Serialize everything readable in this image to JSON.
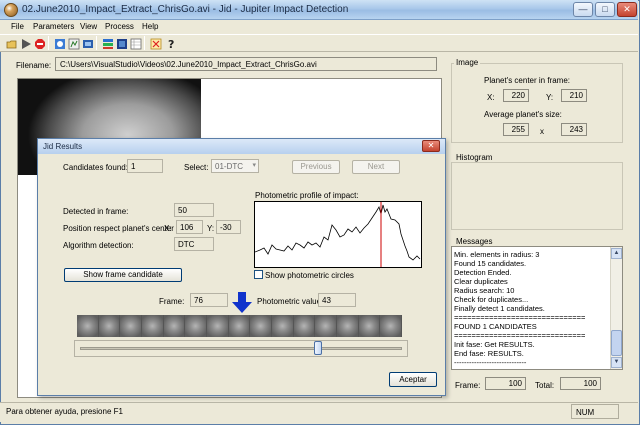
{
  "window": {
    "title": "02.June2010_Impact_Extract_ChrisGo.avi - Jid - Jupiter Impact Detection",
    "minimize": "—",
    "maximize": "□",
    "close": "✕"
  },
  "menu": [
    "File",
    "Parameters",
    "View",
    "Process",
    "Help"
  ],
  "toolbar_icons": [
    "open-icon",
    "play-icon",
    "stop-icon",
    "capture-icon",
    "process-icon",
    "film-icon",
    "layers-icon",
    "stack-icon",
    "grid-icon",
    "chart-icon",
    "help-icon"
  ],
  "filename": {
    "label": "Filename:",
    "value": "C:\\Users\\VisualStudio\\Videos\\02.June2010_Impact_Extract_ChrisGo.avi"
  },
  "image_panel": {
    "title": "Image",
    "center_label": "Planet's center in frame:",
    "x_label": "X:",
    "x_value": "220",
    "y_label": "Y:",
    "y_value": "210",
    "size_label": "Average planet's size:",
    "width_value": "255",
    "times": "x",
    "height_value": "243"
  },
  "histogram": {
    "title": "Histogram"
  },
  "messages": {
    "title": "Messages",
    "lines": [
      "Min. elements in radius: 3",
      "Found 15 candidates.",
      "Detection Ended.",
      "Clear duplicates",
      "Radius search: 10",
      "Check for duplicates...",
      "Finally detect 1 candidates.",
      "==============================",
      "FOUND 1 CANDIDATES",
      "==============================",
      "Init fase: Get RESULTS.",
      "End fase: RESULTS.",
      "-----------------------------"
    ]
  },
  "frame_totals": {
    "frame_label": "Frame:",
    "frame_value": "100",
    "total_label": "Total:",
    "total_value": "100"
  },
  "status": {
    "help_text": "Para obtener ayuda, presione F1",
    "num": "NUM"
  },
  "dialog": {
    "title": "Jid Results",
    "close": "✕",
    "candidates_label": "Candidates found:",
    "candidates_value": "1",
    "select_label": "Select:",
    "select_value": "01-DTC",
    "previous": "Previous",
    "next": "Next",
    "detected_label": "Detected in frame:",
    "detected_value": "50",
    "position_label": "Position respect planet's center",
    "pos_x_label": "X:",
    "pos_x_value": "106",
    "pos_y_label": "Y:",
    "pos_y_value": "-30",
    "algorithm_label": "Algorithm detection:",
    "algorithm_value": "DTC",
    "show_frame_button": "Show frame candidate",
    "profile_label": "Photometric profile of impact:",
    "show_circles_label": "Show photometric circles",
    "frame_label": "Frame:",
    "frame_value": "76",
    "photometric_label": "Photometric value:",
    "photometric_value": "43",
    "accept": "Aceptar",
    "slider_fraction": 0.74,
    "frame_count": 15
  },
  "colors": {
    "marker_line": "#cc0000",
    "arrow": "#1033cc",
    "titlebar": "#a9c8ea"
  }
}
